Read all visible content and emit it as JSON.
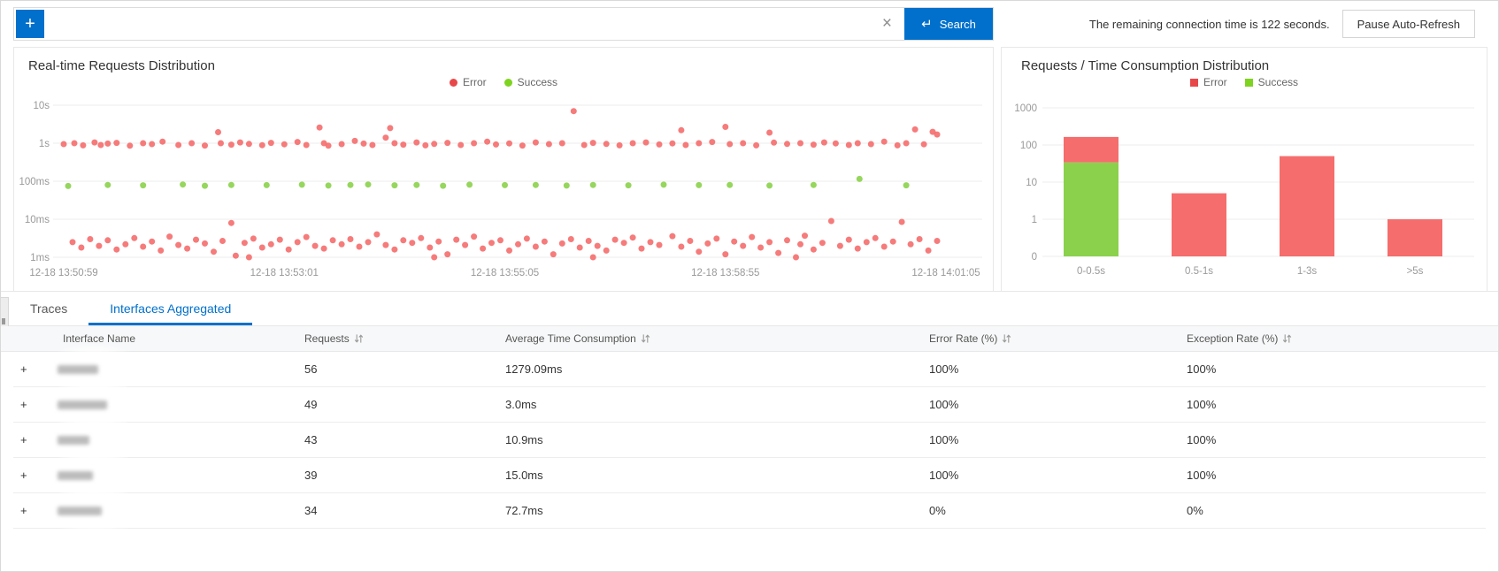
{
  "topbar": {
    "add_button": "+",
    "search_placeholder": "",
    "search_value": "",
    "clear_icon": "×",
    "search_enter_icon": "↵",
    "search_button": "Search",
    "connection_text": "The remaining connection time is 122 seconds.",
    "pause_button": "Pause Auto-Refresh"
  },
  "colors": {
    "accent_blue": "#0070cc",
    "error": "#f56d6d",
    "success": "#8bd14b",
    "legend_error": "#e84749",
    "legend_success": "#7ed321",
    "axis_text": "#999999",
    "grid_line": "#ededed"
  },
  "tabs": {
    "items": [
      {
        "label": "Traces",
        "active": false
      },
      {
        "label": "Interfaces Aggregated",
        "active": true
      }
    ]
  },
  "chart_data": [
    {
      "type": "scatter",
      "title": "Real-time Requests Distribution",
      "legend": [
        "Error",
        "Success"
      ],
      "y_axis": {
        "scale": "log",
        "ticks": [
          "10s",
          "1s",
          "100ms",
          "10ms",
          "1ms"
        ]
      },
      "x_axis": {
        "ticks": [
          "12-18 13:50:59",
          "12-18 13:53:01",
          "12-18 13:55:05",
          "12-18 13:58:55",
          "12-18 14:01:05"
        ]
      },
      "series": [
        {
          "name": "Error",
          "color_key": "error",
          "points_unit": "ms",
          "points": [
            [
              0.0,
              950
            ],
            [
              0.012,
              1000
            ],
            [
              0.022,
              880
            ],
            [
              0.035,
              1050
            ],
            [
              0.042,
              900
            ],
            [
              0.05,
              980
            ],
            [
              0.06,
              1020
            ],
            [
              0.075,
              860
            ],
            [
              0.09,
              1000
            ],
            [
              0.1,
              950
            ],
            [
              0.112,
              1100
            ],
            [
              0.13,
              900
            ],
            [
              0.145,
              1000
            ],
            [
              0.16,
              870
            ],
            [
              0.175,
              1950
            ],
            [
              0.178,
              1000
            ],
            [
              0.19,
              920
            ],
            [
              0.2,
              1050
            ],
            [
              0.21,
              960
            ],
            [
              0.225,
              890
            ],
            [
              0.235,
              1020
            ],
            [
              0.25,
              940
            ],
            [
              0.265,
              1080
            ],
            [
              0.275,
              900
            ],
            [
              0.29,
              2600
            ],
            [
              0.295,
              1000
            ],
            [
              0.3,
              860
            ],
            [
              0.315,
              950
            ],
            [
              0.33,
              1150
            ],
            [
              0.34,
              980
            ],
            [
              0.35,
              900
            ],
            [
              0.365,
              1400
            ],
            [
              0.37,
              2500
            ],
            [
              0.375,
              1000
            ],
            [
              0.385,
              920
            ],
            [
              0.4,
              1050
            ],
            [
              0.41,
              880
            ],
            [
              0.42,
              960
            ],
            [
              0.435,
              1020
            ],
            [
              0.45,
              900
            ],
            [
              0.465,
              1000
            ],
            [
              0.48,
              1100
            ],
            [
              0.49,
              930
            ],
            [
              0.505,
              990
            ],
            [
              0.52,
              870
            ],
            [
              0.535,
              1050
            ],
            [
              0.55,
              950
            ],
            [
              0.565,
              1000
            ],
            [
              0.578,
              7000
            ],
            [
              0.59,
              900
            ],
            [
              0.6,
              1020
            ],
            [
              0.615,
              960
            ],
            [
              0.63,
              880
            ],
            [
              0.645,
              1000
            ],
            [
              0.66,
              1050
            ],
            [
              0.675,
              930
            ],
            [
              0.69,
              990
            ],
            [
              0.7,
              2200
            ],
            [
              0.705,
              900
            ],
            [
              0.72,
              1000
            ],
            [
              0.735,
              1080
            ],
            [
              0.75,
              2700
            ],
            [
              0.755,
              950
            ],
            [
              0.77,
              1000
            ],
            [
              0.785,
              880
            ],
            [
              0.8,
              1900
            ],
            [
              0.805,
              1040
            ],
            [
              0.82,
              960
            ],
            [
              0.835,
              1000
            ],
            [
              0.85,
              920
            ],
            [
              0.862,
              1050
            ],
            [
              0.875,
              990
            ],
            [
              0.89,
              900
            ],
            [
              0.9,
              1000
            ],
            [
              0.915,
              950
            ],
            [
              0.93,
              1100
            ],
            [
              0.945,
              880
            ],
            [
              0.955,
              1000
            ],
            [
              0.965,
              2300
            ],
            [
              0.975,
              940
            ],
            [
              0.985,
              2000
            ],
            [
              0.99,
              1700
            ],
            [
              0.01,
              2.5
            ],
            [
              0.02,
              1.8
            ],
            [
              0.03,
              3
            ],
            [
              0.04,
              2
            ],
            [
              0.05,
              2.8
            ],
            [
              0.06,
              1.6
            ],
            [
              0.07,
              2.2
            ],
            [
              0.08,
              3.2
            ],
            [
              0.09,
              1.9
            ],
            [
              0.1,
              2.6
            ],
            [
              0.11,
              1.5
            ],
            [
              0.12,
              3.5
            ],
            [
              0.13,
              2.1
            ],
            [
              0.14,
              1.7
            ],
            [
              0.15,
              2.9
            ],
            [
              0.16,
              2.3
            ],
            [
              0.17,
              1.4
            ],
            [
              0.18,
              2.7
            ],
            [
              0.19,
              8
            ],
            [
              0.195,
              1.1
            ],
            [
              0.205,
              2.4
            ],
            [
              0.21,
              1
            ],
            [
              0.215,
              3.1
            ],
            [
              0.225,
              1.8
            ],
            [
              0.235,
              2.2
            ],
            [
              0.245,
              2.9
            ],
            [
              0.255,
              1.6
            ],
            [
              0.265,
              2.5
            ],
            [
              0.275,
              3.4
            ],
            [
              0.285,
              2
            ],
            [
              0.295,
              1.7
            ],
            [
              0.305,
              2.8
            ],
            [
              0.315,
              2.2
            ],
            [
              0.325,
              3
            ],
            [
              0.335,
              1.9
            ],
            [
              0.345,
              2.5
            ],
            [
              0.355,
              4
            ],
            [
              0.365,
              2.1
            ],
            [
              0.375,
              1.6
            ],
            [
              0.385,
              2.8
            ],
            [
              0.395,
              2.4
            ],
            [
              0.405,
              3.2
            ],
            [
              0.415,
              1.8
            ],
            [
              0.42,
              1
            ],
            [
              0.425,
              2.6
            ],
            [
              0.435,
              1.2
            ],
            [
              0.445,
              2.9
            ],
            [
              0.455,
              2.1
            ],
            [
              0.465,
              3.5
            ],
            [
              0.475,
              1.7
            ],
            [
              0.485,
              2.4
            ],
            [
              0.495,
              2.8
            ],
            [
              0.505,
              1.5
            ],
            [
              0.515,
              2.2
            ],
            [
              0.525,
              3.1
            ],
            [
              0.535,
              1.9
            ],
            [
              0.545,
              2.6
            ],
            [
              0.555,
              1.2
            ],
            [
              0.565,
              2.3
            ],
            [
              0.575,
              3
            ],
            [
              0.585,
              1.8
            ],
            [
              0.595,
              2.7
            ],
            [
              0.6,
              1
            ],
            [
              0.605,
              2
            ],
            [
              0.615,
              1.5
            ],
            [
              0.625,
              2.9
            ],
            [
              0.635,
              2.4
            ],
            [
              0.645,
              3.3
            ],
            [
              0.655,
              1.7
            ],
            [
              0.665,
              2.5
            ],
            [
              0.675,
              2.1
            ],
            [
              0.69,
              3.6
            ],
            [
              0.7,
              1.9
            ],
            [
              0.71,
              2.7
            ],
            [
              0.72,
              1.4
            ],
            [
              0.73,
              2.3
            ],
            [
              0.74,
              3.1
            ],
            [
              0.75,
              1.2
            ],
            [
              0.76,
              2.6
            ],
            [
              0.77,
              2
            ],
            [
              0.78,
              3.4
            ],
            [
              0.79,
              1.8
            ],
            [
              0.8,
              2.5
            ],
            [
              0.81,
              1.3
            ],
            [
              0.82,
              2.8
            ],
            [
              0.83,
              1
            ],
            [
              0.835,
              2.2
            ],
            [
              0.84,
              3.7
            ],
            [
              0.85,
              1.6
            ],
            [
              0.86,
              2.4
            ],
            [
              0.87,
              9
            ],
            [
              0.88,
              2
            ],
            [
              0.89,
              2.9
            ],
            [
              0.9,
              1.7
            ],
            [
              0.91,
              2.5
            ],
            [
              0.92,
              3.2
            ],
            [
              0.93,
              1.9
            ],
            [
              0.94,
              2.6
            ],
            [
              0.95,
              8.5
            ],
            [
              0.96,
              2.2
            ],
            [
              0.97,
              3
            ],
            [
              0.98,
              1.5
            ],
            [
              0.99,
              2.7
            ]
          ]
        },
        {
          "name": "Success",
          "color_key": "success",
          "points_unit": "ms",
          "points": [
            [
              0.005,
              75
            ],
            [
              0.05,
              80
            ],
            [
              0.09,
              78
            ],
            [
              0.135,
              82
            ],
            [
              0.16,
              76
            ],
            [
              0.19,
              80
            ],
            [
              0.23,
              79
            ],
            [
              0.27,
              81
            ],
            [
              0.3,
              77
            ],
            [
              0.325,
              80
            ],
            [
              0.345,
              82
            ],
            [
              0.375,
              78
            ],
            [
              0.4,
              80
            ],
            [
              0.43,
              76
            ],
            [
              0.46,
              81
            ],
            [
              0.5,
              79
            ],
            [
              0.535,
              80
            ],
            [
              0.57,
              77
            ],
            [
              0.6,
              80
            ],
            [
              0.64,
              78
            ],
            [
              0.68,
              81
            ],
            [
              0.72,
              79
            ],
            [
              0.755,
              80
            ],
            [
              0.8,
              77
            ],
            [
              0.85,
              80
            ],
            [
              0.902,
              115
            ],
            [
              0.955,
              78
            ]
          ]
        }
      ]
    },
    {
      "type": "bar",
      "title": "Requests / Time Consumption Distribution",
      "legend": [
        "Error",
        "Success"
      ],
      "stacked": true,
      "y_axis": {
        "scale": "log",
        "ticks": [
          "1000",
          "100",
          "10",
          "1",
          "0"
        ]
      },
      "categories": [
        "0-0.5s",
        "0.5-1s",
        "1-3s",
        ">5s"
      ],
      "series": [
        {
          "name": "Success",
          "color_key": "success",
          "values": [
            34,
            0,
            0,
            0
          ]
        },
        {
          "name": "Error",
          "color_key": "error",
          "values": [
            131,
            5,
            50,
            1
          ]
        }
      ]
    }
  ],
  "table": {
    "expander": "+",
    "columns": [
      {
        "label": "Interface Name",
        "sortable": false
      },
      {
        "label": "Requests",
        "sortable": true
      },
      {
        "label": "Average Time Consumption",
        "sortable": true
      },
      {
        "label": "Error Rate (%)",
        "sortable": true
      },
      {
        "label": "Exception Rate (%)",
        "sortable": true
      }
    ],
    "rows": [
      {
        "name_redacted": true,
        "redact_width": 46,
        "requests": "56",
        "avg_time": "1279.09ms",
        "error_rate": "100%",
        "exception_rate": "100%"
      },
      {
        "name_redacted": true,
        "redact_width": 56,
        "requests": "49",
        "avg_time": "3.0ms",
        "error_rate": "100%",
        "exception_rate": "100%"
      },
      {
        "name_redacted": true,
        "redact_width": 36,
        "requests": "43",
        "avg_time": "10.9ms",
        "error_rate": "100%",
        "exception_rate": "100%"
      },
      {
        "name_redacted": true,
        "redact_width": 40,
        "requests": "39",
        "avg_time": "15.0ms",
        "error_rate": "100%",
        "exception_rate": "100%"
      },
      {
        "name_redacted": true,
        "redact_width": 50,
        "requests": "34",
        "avg_time": "72.7ms",
        "error_rate": "0%",
        "exception_rate": "0%"
      }
    ]
  }
}
